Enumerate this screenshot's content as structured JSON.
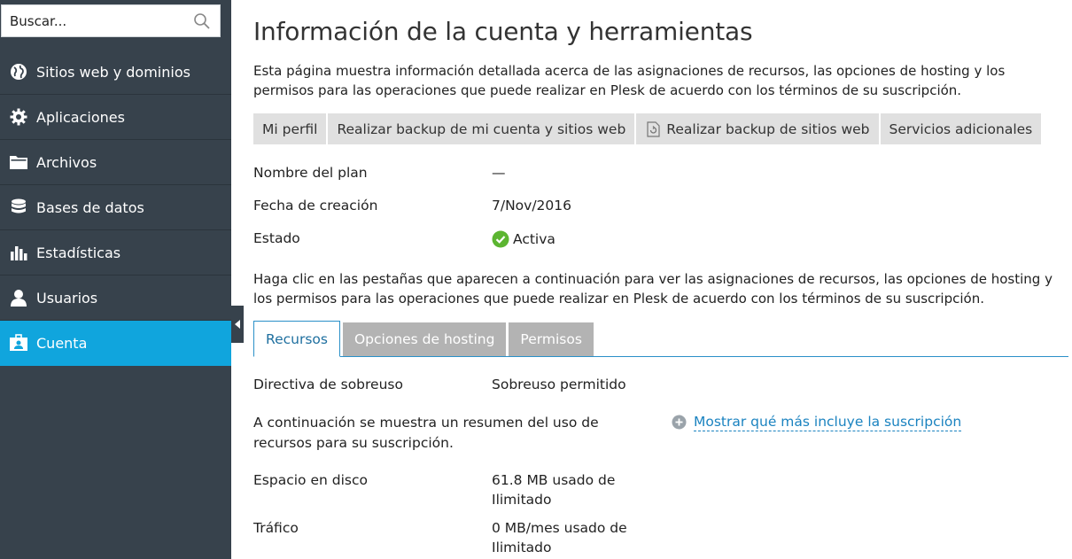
{
  "sidebar": {
    "search_placeholder": "Buscar...",
    "items": [
      {
        "label": "Sitios web y dominios",
        "icon": "globe-icon"
      },
      {
        "label": "Aplicaciones",
        "icon": "gear-icon"
      },
      {
        "label": "Archivos",
        "icon": "folder-icon"
      },
      {
        "label": "Bases de datos",
        "icon": "database-icon"
      },
      {
        "label": "Estadísticas",
        "icon": "bar-chart-icon"
      },
      {
        "label": "Usuarios",
        "icon": "user-icon"
      },
      {
        "label": "Cuenta",
        "icon": "account-icon",
        "active": true
      }
    ]
  },
  "page": {
    "title": "Información de la cuenta y herramientas",
    "intro": "Esta página muestra información detallada acerca de las asignaciones de recursos, las opciones de hosting y los permisos para las operaciones que puede realizar en Plesk de acuerdo con los términos de su suscripción."
  },
  "toolbar": {
    "profile": "Mi perfil",
    "backup_account": "Realizar backup de mi cuenta y sitios web",
    "backup_sites": "Realizar backup de sitios web",
    "extra_services": "Servicios adicionales"
  },
  "info": {
    "plan_label": "Nombre del plan",
    "plan_value": "—",
    "created_label": "Fecha de creación",
    "created_value": "7/Nov/2016",
    "status_label": "Estado",
    "status_value": "Activa"
  },
  "tabs_intro": "Haga clic en las pestañas que aparecen a continuación para ver las asignaciones de recursos, las opciones de hosting y los permisos para las operaciones que puede realizar en Plesk de acuerdo con los términos de su suscripción.",
  "tabs": [
    "Recursos",
    "Opciones de hosting",
    "Permisos"
  ],
  "resources": {
    "overuse_label": "Directiva de sobreuso",
    "overuse_value": "Sobreuso permitido",
    "summary": "A continuación se muestra un resumen del uso de recursos para su suscripción.",
    "more_link": "Mostrar qué más incluye la suscripción",
    "disk_label": "Espacio en disco",
    "disk_value": "61.8 MB usado de Ilimitado",
    "traffic_label": "Tráfico",
    "traffic_value": "0 MB/mes usado de Ilimitado"
  },
  "colors": {
    "sidebar_bg": "#37424c",
    "active_item": "#10a5dd",
    "link": "#1b83c0",
    "status_ok": "#5cb531"
  }
}
